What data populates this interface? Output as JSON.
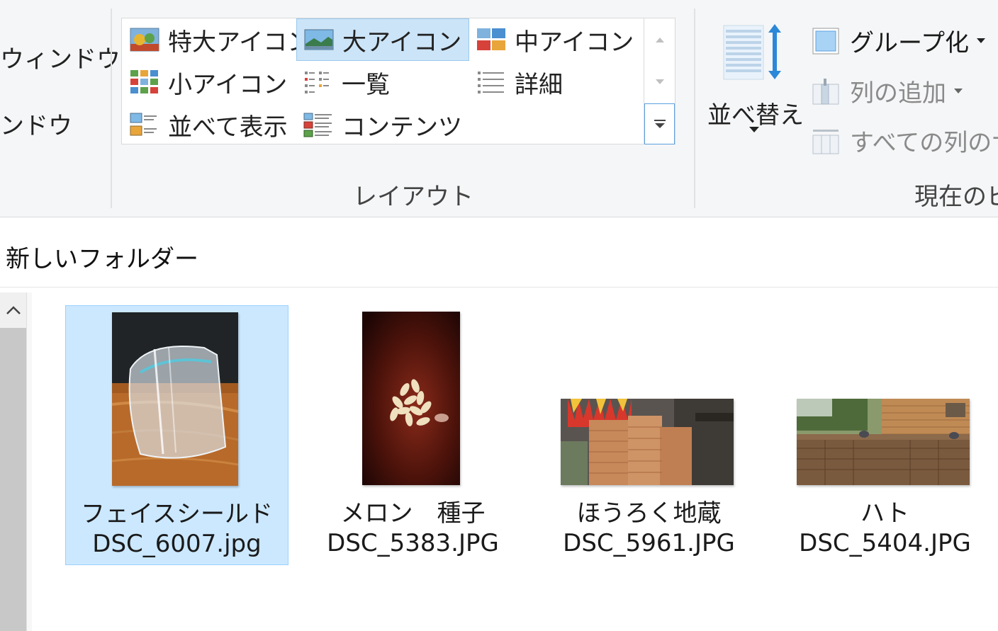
{
  "ribbon": {
    "pane_items": [
      "ウィンドウ",
      "ンドウ"
    ],
    "layout": {
      "group_label": "レイアウト",
      "items": [
        {
          "label": "特大アイコン",
          "icon": "extra-large-icons-icon",
          "selected": false
        },
        {
          "label": "大アイコン",
          "icon": "large-icons-icon",
          "selected": true
        },
        {
          "label": "中アイコン",
          "icon": "medium-icons-icon",
          "selected": false
        },
        {
          "label": "小アイコン",
          "icon": "small-icons-icon",
          "selected": false
        },
        {
          "label": "一覧",
          "icon": "list-icon",
          "selected": false
        },
        {
          "label": "詳細",
          "icon": "details-icon",
          "selected": false
        },
        {
          "label": "並べて表示",
          "icon": "tiles-icon",
          "selected": false
        },
        {
          "label": "コンテンツ",
          "icon": "content-icon",
          "selected": false
        }
      ]
    },
    "current_view": {
      "group_label": "現在のビ",
      "sort_label": "並べ替え",
      "group_by": "グループ化",
      "add_columns": "列の追加",
      "size_all_columns": "すべての列のサ"
    }
  },
  "folder": {
    "title": "新しいフォルダー"
  },
  "files": [
    {
      "name": "フェイスシールド",
      "filename": "DSC_6007.jpg",
      "selected": true
    },
    {
      "name": "メロン　種子",
      "filename": "DSC_5383.JPG",
      "selected": false
    },
    {
      "name": "ほうろく地蔵",
      "filename": "DSC_5961.JPG",
      "selected": false
    },
    {
      "name": "ハト",
      "filename": "DSC_5404.JPG",
      "selected": false
    }
  ],
  "colors": {
    "selection_bg": "#cce8ff",
    "selection_border": "#99d1ff",
    "ribbon_bg": "#f5f6f7",
    "accent": "#2b88d8"
  }
}
